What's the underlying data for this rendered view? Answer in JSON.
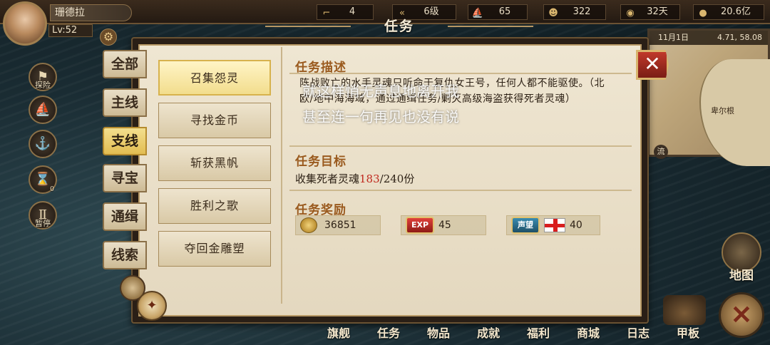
{
  "player": {
    "name": "珊德拉",
    "level": "Lv:52"
  },
  "resources": [
    {
      "icon": "boot-icon",
      "glyph": "⌐",
      "value": "4"
    },
    {
      "icon": "arrow-rank-icon",
      "glyph": "«",
      "value": "6级"
    },
    {
      "icon": "ship-icon",
      "glyph": "⛵",
      "value": "65"
    },
    {
      "icon": "crew-icon",
      "glyph": "☻",
      "value": "322"
    },
    {
      "icon": "bread-icon",
      "glyph": "◉",
      "value": "32天"
    },
    {
      "icon": "coin-icon",
      "glyph": "●",
      "value": "20.6亿"
    }
  ],
  "window": {
    "title": "任务",
    "close_label": "✕"
  },
  "side_buttons": [
    {
      "label": "探险",
      "glyph": "⚑"
    },
    {
      "label": "",
      "glyph": "⛵"
    },
    {
      "label": "",
      "glyph": "⚓"
    },
    {
      "label": "0",
      "glyph": "⌛"
    },
    {
      "label": "暂停",
      "glyph": "Ⅱ"
    }
  ],
  "categories": [
    {
      "label": "全部",
      "active": false
    },
    {
      "label": "主线",
      "active": false
    },
    {
      "label": "支线",
      "active": true
    },
    {
      "label": "寻宝",
      "active": false
    },
    {
      "label": "通缉",
      "active": false
    },
    {
      "label": "线索",
      "active": false
    }
  ],
  "tasks": [
    {
      "label": "召集怨灵",
      "active": true
    },
    {
      "label": "寻找金币",
      "active": false
    },
    {
      "label": "斩获黑帆",
      "active": false
    },
    {
      "label": "胜利之歌",
      "active": false
    },
    {
      "label": "夺回金雕塑",
      "active": false
    }
  ],
  "detail": {
    "desc_title": "任务描述",
    "description": "阵战败亡的水手灵魂只听命于复仇女王号，任何人都不能驱使。（北欧/地中海海域，通过通缉任务/剿灭高级海盗获得死者灵魂）",
    "goal_title": "任务目标",
    "goal_prefix": "收集死者灵魂",
    "goal_current": "183",
    "goal_suffix": "/240份",
    "reward_title": "任务奖励",
    "rewards": {
      "gold": "36851",
      "exp_badge": "EXP",
      "exp": "45",
      "fame_badge": "声望",
      "fame": "40"
    }
  },
  "minimap": {
    "date": "11月1日",
    "coords": "4.71, 58.08",
    "city": "卑尔根",
    "flow_label": "流"
  },
  "map_button": {
    "label": "地图"
  },
  "bottom_nav": [
    "旗舰",
    "任务",
    "物品",
    "成就",
    "福利",
    "商城",
    "日志",
    "甲板"
  ],
  "overlay": {
    "line1": "就这样悄无声息地离开我",
    "line2": "甚至连一句再见也没有说"
  },
  "colors": {
    "accent": "#9a5a1e",
    "highlight": "#c0281e",
    "active_tab": "#e2bd52"
  }
}
